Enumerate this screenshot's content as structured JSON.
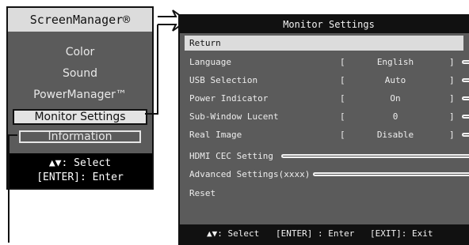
{
  "left_menu": {
    "title": "ScreenManager®",
    "items": [
      {
        "label": "Color"
      },
      {
        "label": "Sound"
      },
      {
        "label": "PowerManager™"
      },
      {
        "label": "Monitor Settings"
      },
      {
        "label": "Information"
      }
    ],
    "help": {
      "select_text": "▲▼: Select",
      "enter_text": "[ENTER]: Enter"
    }
  },
  "monitor_settings": {
    "title": "Monitor Settings",
    "return_label": "Return",
    "rows": [
      {
        "label": "Language",
        "value": "English"
      },
      {
        "label": "USB Selection",
        "value": "Auto"
      },
      {
        "label": "Power Indicator",
        "value": "On"
      },
      {
        "label": "Sub-Window Lucent",
        "value": "0"
      },
      {
        "label": "Real Image",
        "value": "Disable"
      }
    ],
    "bracket_open": "[",
    "bracket_close": "]",
    "links": [
      {
        "label": "HDMI CEC Setting"
      },
      {
        "label": "Advanced Settings(xxxx)"
      },
      {
        "label": "Reset"
      }
    ],
    "bottom_bar": {
      "select": "▲▼: Select",
      "enter": "[ENTER] : Enter",
      "exit": "[EXIT]: Exit"
    }
  },
  "colors": {
    "panel_gray": "#5b5b5b",
    "highlight": "#dcdcdc",
    "bar_black": "#111111"
  }
}
